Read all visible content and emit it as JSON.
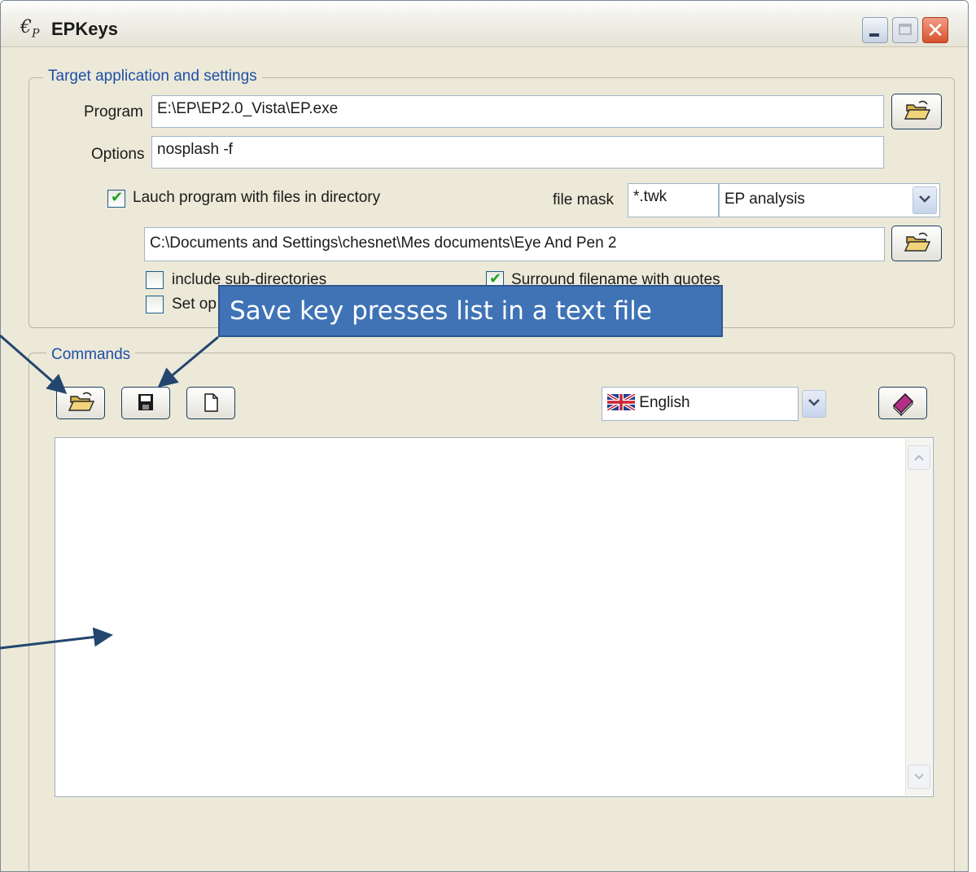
{
  "window": {
    "title": "EPKeys",
    "icon_letter": "€",
    "icon_sub": "P",
    "close_glyph": "✕"
  },
  "target_group": {
    "legend": "Target application and settings",
    "program_label": "Program",
    "program_value": "E:\\EP\\EP2.0_Vista\\EP.exe",
    "options_label": "Options",
    "options_value": "nosplash -f",
    "launch_checkbox_label": "Lauch program with files in directory",
    "launch_checked": true,
    "file_mask_label": "file mask",
    "file_mask_value": "*.twk",
    "file_type_value": "EP analysis",
    "directory_value": "C:\\Documents and Settings\\chesnet\\Mes documents\\Eye And Pen 2",
    "include_subdirs_label": "include sub-directories",
    "include_subdirs_checked": false,
    "surround_quotes_label": "Surround filename with quotes",
    "surround_quotes_checked": true,
    "set_options_label_visible": "Set op",
    "set_options_checked": false
  },
  "commands_group": {
    "legend": "Commands",
    "language_value": "English"
  },
  "annotation": {
    "callout_text": "Save key presses list in a text file"
  },
  "icons": {
    "open_folder": "open-folder-icon",
    "save": "floppy-disk-icon",
    "new_document": "new-document-icon",
    "help_book": "help-book-icon",
    "uk_flag": "uk-flag-icon"
  },
  "colors": {
    "accent_blue": "#3f73b5",
    "legend_text": "#1f4fa8",
    "window_bg": "#ece9d8",
    "check_green": "#21a121"
  }
}
